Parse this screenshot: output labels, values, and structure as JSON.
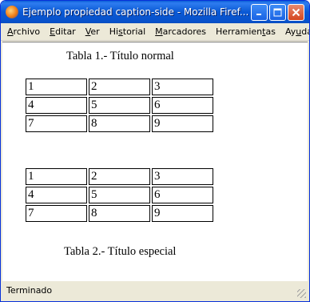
{
  "window": {
    "title": "Ejemplo propiedad caption-side - Mozilla Firef..."
  },
  "menu": {
    "items": [
      {
        "acc": "A",
        "rest": "rchivo"
      },
      {
        "acc": "E",
        "rest": "ditar"
      },
      {
        "acc": "V",
        "rest": "er"
      },
      {
        "pre": "Hi",
        "acc": "s",
        "rest": "torial"
      },
      {
        "acc": "M",
        "rest": "arcadores"
      },
      {
        "pre": "Herramien",
        "acc": "t",
        "rest": "as"
      },
      {
        "pre": "Ay",
        "acc": "u",
        "rest": "da"
      }
    ]
  },
  "page": {
    "table1": {
      "caption": "Tabla 1.- Título normal",
      "rows": [
        [
          "1",
          "2",
          "3"
        ],
        [
          "4",
          "5",
          "6"
        ],
        [
          "7",
          "8",
          "9"
        ]
      ]
    },
    "table2": {
      "caption": "Tabla 2.- Título especial",
      "rows": [
        [
          "1",
          "2",
          "3"
        ],
        [
          "4",
          "5",
          "6"
        ],
        [
          "7",
          "8",
          "9"
        ]
      ]
    }
  },
  "status": {
    "text": "Terminado"
  }
}
